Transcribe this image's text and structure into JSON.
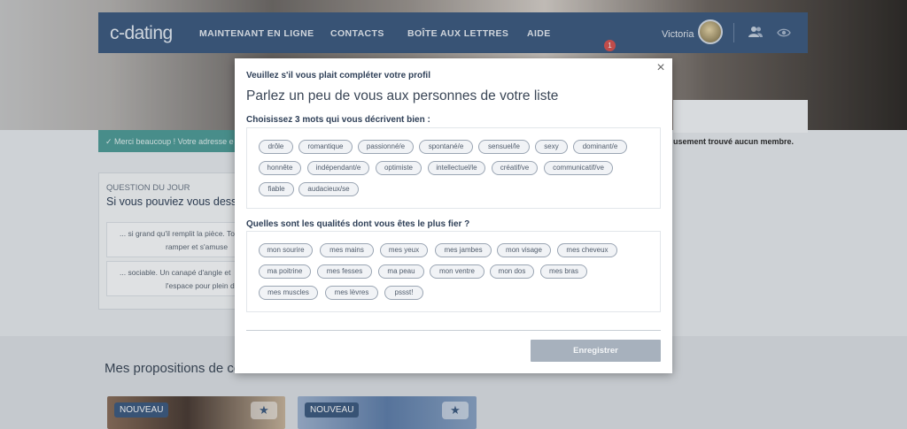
{
  "header": {
    "logo": "c-dating",
    "nav": [
      "MAINTENANT EN LIGNE",
      "CONTACTS",
      "BOÎTE AUX LETTRES",
      "AIDE"
    ],
    "mailbox_badge": "1",
    "user_name": "Victoria"
  },
  "notice": {
    "text": "Merci beaucoup ! Votre adresse e"
  },
  "right_text": "usement trouvé aucun membre.",
  "question": {
    "kicker": "QUESTION DU JOUR",
    "title": "Si vous pouviez vous dessi",
    "answers": [
      {
        "line1": "... si grand qu'il remplit la pièce. Tou",
        "line2": "ramper et s'amuse"
      },
      {
        "line1": "... sociable. Un canapé d'angle et",
        "line2": "l'espace pour plein d'a"
      }
    ]
  },
  "propositions": {
    "title": "Mes propositions de contact",
    "cards": [
      {
        "tag": "NOUVEAU",
        "star": "★"
      },
      {
        "tag": "NOUVEAU",
        "star": "★"
      }
    ]
  },
  "modal": {
    "close": "×",
    "kicker": "Veuillez s'il vous plait compléter votre profil",
    "title": "Parlez un peu de vous aux personnes de votre liste",
    "words_label": "Choisissez 3 mots qui vous décrivent bien :",
    "words": [
      "drôle",
      "romantique",
      "passionné/e",
      "spontané/e",
      "sensuel/le",
      "sexy",
      "dominant/e",
      "honnête",
      "indépendant/e",
      "optimiste",
      "intellectuel/le",
      "créatif/ve",
      "communicatif/ve",
      "fiable",
      "audacieux/se"
    ],
    "qualities_label": "Quelles sont les qualités dont vous êtes le plus fier ?",
    "qualities": [
      "mon sourire",
      "mes mains",
      "mes yeux",
      "mes jambes",
      "mon visage",
      "mes cheveux",
      "ma poitrine",
      "mes fesses",
      "ma peau",
      "mon ventre",
      "mon dos",
      "mes bras",
      "mes muscles",
      "mes lèvres",
      "pssst!"
    ],
    "save_label": "Enregistrer"
  },
  "colors": {
    "nav_bg": "#3d5a80",
    "notice_bg": "#4f9d98",
    "badge": "#d8534f",
    "save_btn": "#a7b1bd"
  }
}
